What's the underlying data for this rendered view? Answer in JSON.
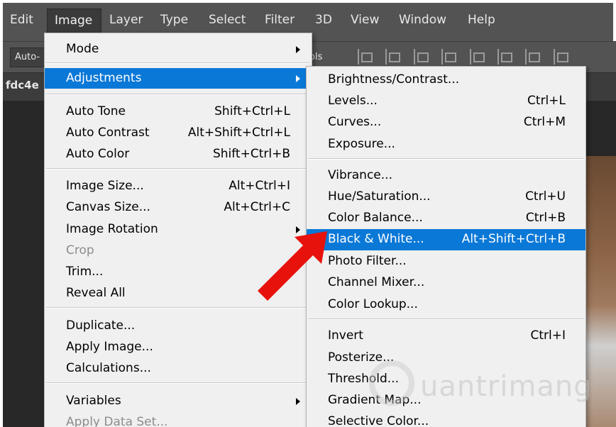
{
  "menubar": {
    "items": [
      "Edit",
      "Image",
      "Layer",
      "Type",
      "Select",
      "Filter",
      "3D",
      "View",
      "Window",
      "Help"
    ]
  },
  "options_bar": {
    "auto_label": "Auto-",
    "tools_text": "ols"
  },
  "document": {
    "tab_label": "fdc4e"
  },
  "image_menu": {
    "mode": "Mode",
    "adjustments": "Adjustments",
    "auto_tone": {
      "label": "Auto Tone",
      "shortcut": "Shift+Ctrl+L"
    },
    "auto_contrast": {
      "label": "Auto Contrast",
      "shortcut": "Alt+Shift+Ctrl+L"
    },
    "auto_color": {
      "label": "Auto Color",
      "shortcut": "Shift+Ctrl+B"
    },
    "image_size": {
      "label": "Image Size...",
      "shortcut": "Alt+Ctrl+I"
    },
    "canvas_size": {
      "label": "Canvas Size...",
      "shortcut": "Alt+Ctrl+C"
    },
    "image_rotation": "Image Rotation",
    "crop": "Crop",
    "trim": "Trim...",
    "reveal_all": "Reveal All",
    "duplicate": "Duplicate...",
    "apply_image": "Apply Image...",
    "calculations": "Calculations...",
    "variables": "Variables",
    "apply_data_set": "Apply Data Set..."
  },
  "adjustments_menu": {
    "brightness_contrast": {
      "label": "Brightness/Contrast...",
      "shortcut": ""
    },
    "levels": {
      "label": "Levels...",
      "shortcut": "Ctrl+L"
    },
    "curves": {
      "label": "Curves...",
      "shortcut": "Ctrl+M"
    },
    "exposure": {
      "label": "Exposure...",
      "shortcut": ""
    },
    "vibrance": {
      "label": "Vibrance...",
      "shortcut": ""
    },
    "hue_saturation": {
      "label": "Hue/Saturation...",
      "shortcut": "Ctrl+U"
    },
    "color_balance": {
      "label": "Color Balance...",
      "shortcut": "Ctrl+B"
    },
    "black_white": {
      "label": "Black & White...",
      "shortcut": "Alt+Shift+Ctrl+B"
    },
    "photo_filter": {
      "label": "Photo Filter...",
      "shortcut": ""
    },
    "channel_mixer": {
      "label": "Channel Mixer...",
      "shortcut": ""
    },
    "color_lookup": {
      "label": "Color Lookup...",
      "shortcut": ""
    },
    "invert": {
      "label": "Invert",
      "shortcut": "Ctrl+I"
    },
    "posterize": {
      "label": "Posterize...",
      "shortcut": ""
    },
    "threshold": {
      "label": "Threshold...",
      "shortcut": ""
    },
    "gradient_map": {
      "label": "Gradient Map...",
      "shortcut": ""
    },
    "selective_color": {
      "label": "Selective Color...",
      "shortcut": ""
    }
  },
  "watermark": {
    "text": "uantrimang"
  },
  "colors": {
    "highlight": "#0a78d7",
    "menu_bg": "#f0f0f0",
    "chrome_bg": "#535353",
    "annotation_arrow": "#e8120c"
  },
  "icons": {
    "submenu": "chevron-right-icon",
    "annotation": "red-arrow-icon"
  }
}
